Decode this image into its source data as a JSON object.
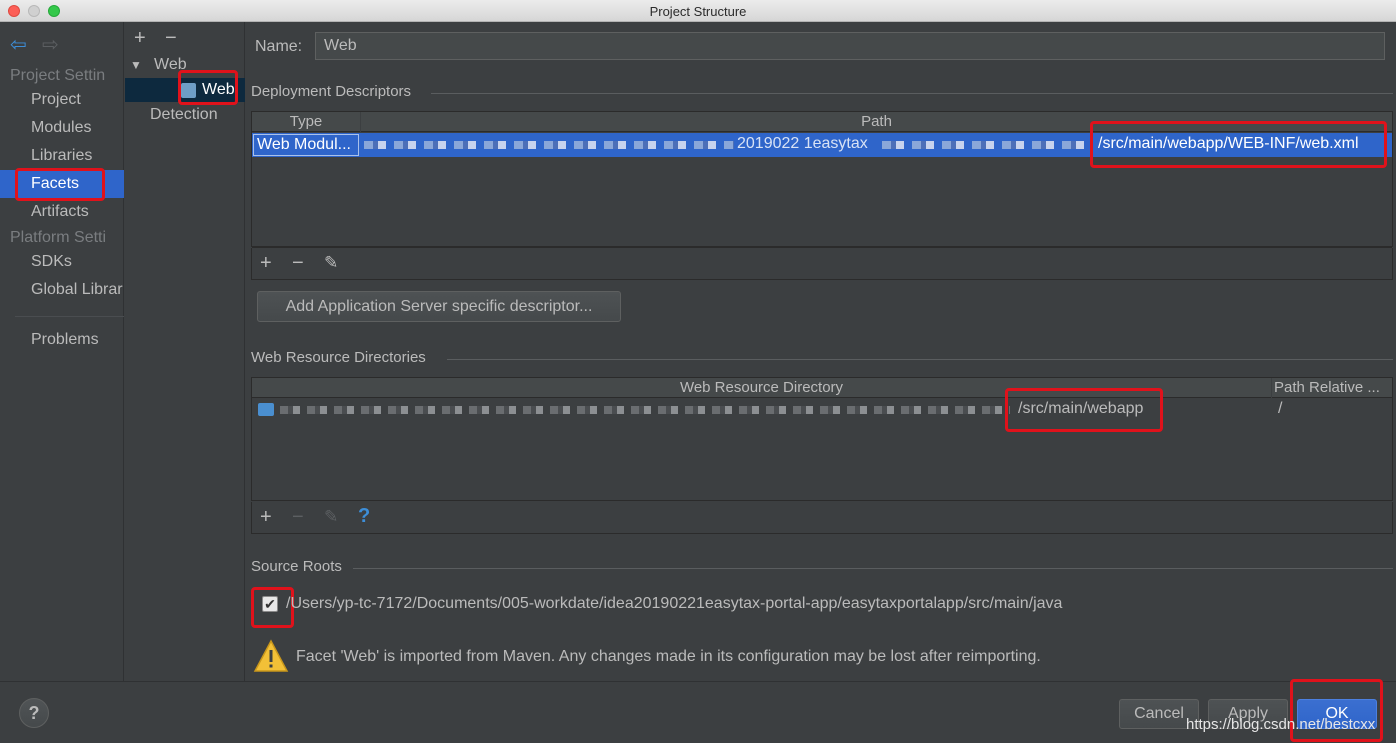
{
  "window": {
    "title": "Project Structure"
  },
  "nav": {
    "project_settings_header": "Project Settin",
    "items_project": [
      "Project",
      "Modules",
      "Libraries",
      "Facets",
      "Artifacts"
    ],
    "platform_settings_header": "Platform Setti",
    "items_platform": [
      "SDKs",
      "Global Librar"
    ],
    "problems": "Problems"
  },
  "tree": {
    "root": "Web",
    "child": "Web",
    "detection": "Detection"
  },
  "main": {
    "name_label": "Name:",
    "name_value": "Web",
    "deployment": {
      "title": "Deployment Descriptors",
      "col_type": "Type",
      "col_path": "Path",
      "row_type": "Web Modul...",
      "row_path_visible_mid": "2019022 1easytax",
      "row_path_end": "/src/main/webapp/WEB-INF/web.xml",
      "add_button": "Add Application Server specific descriptor..."
    },
    "resources": {
      "title": "Web Resource Directories",
      "col_dir": "Web Resource Directory",
      "col_rel": "Path Relative ...",
      "row_dir_end": "/src/main/webapp",
      "row_rel": "/"
    },
    "source_roots": {
      "title": "Source Roots",
      "path": "/Users/yp-tc-7172/Documents/005-workdate/idea20190221easytax-portal-app/easytaxportalapp/src/main/java",
      "checked": true
    },
    "warning": "Facet 'Web' is imported from Maven. Any changes made in its configuration may be lost after reimporting."
  },
  "footer": {
    "help": "?",
    "cancel": "Cancel",
    "apply": "Apply",
    "ok": "OK",
    "watermark": "https://blog.csdn.net/bestcxx"
  },
  "colors": {
    "accent": "#2f65ca",
    "highlight": "#e0121b",
    "warning": "#f2c037"
  }
}
